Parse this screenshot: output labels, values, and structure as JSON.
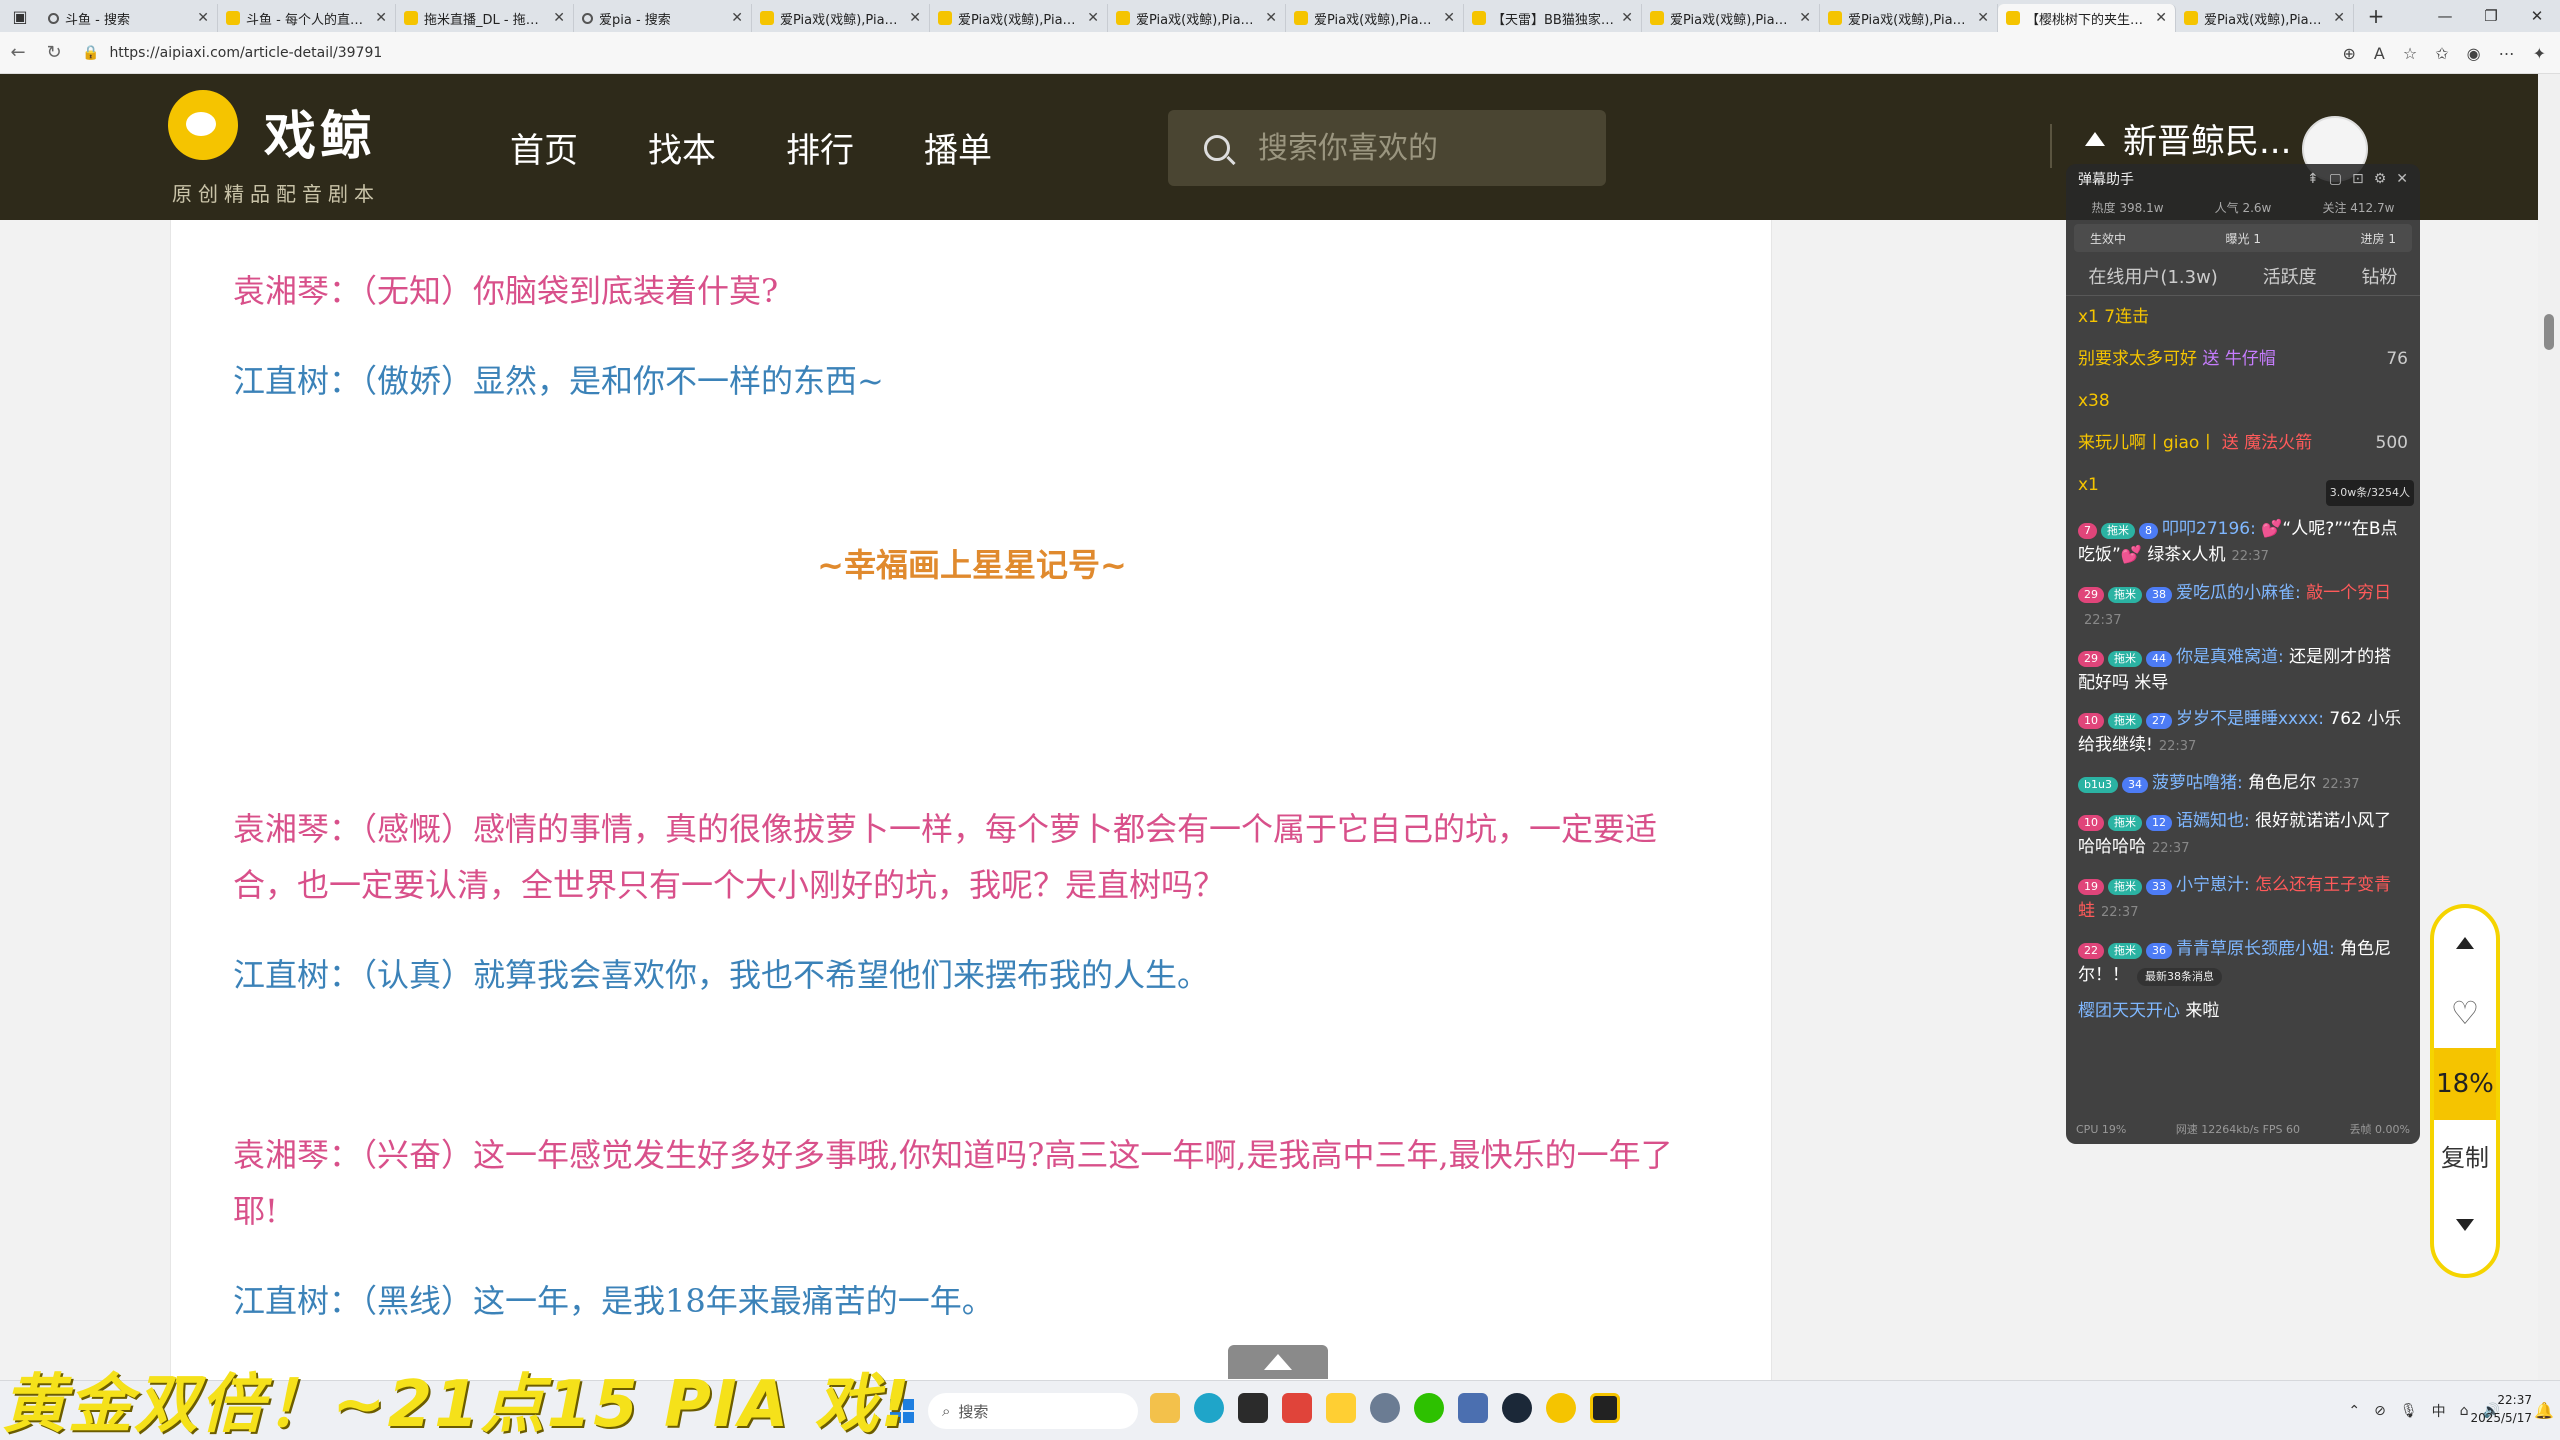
{
  "browser": {
    "tabs": [
      {
        "title": "斗鱼 - 搜索",
        "fav": "search"
      },
      {
        "title": "斗鱼 - 每个人的直播平台",
        "fav": "site"
      },
      {
        "title": "拖米直播_DL - 拖米直播",
        "fav": "site"
      },
      {
        "title": "爱pia - 搜索",
        "fav": "search"
      },
      {
        "title": "爱Pia戏(戏鲸),Pia戏剧本",
        "fav": "site"
      },
      {
        "title": "爱Pia戏(戏鲸),Pia戏剧本",
        "fav": "site"
      },
      {
        "title": "爱Pia戏(戏鲸),Pia戏剧本",
        "fav": "site"
      },
      {
        "title": "爱Pia戏(戏鲸),Pia戏剧本",
        "fav": "site"
      },
      {
        "title": "【天雷】BB猫独家剧本",
        "fav": "site"
      },
      {
        "title": "爱Pia戏(戏鲸),Pia戏剧本",
        "fav": "site"
      },
      {
        "title": "爱Pia戏(戏鲸),Pia戏剧本",
        "fav": "site"
      },
      {
        "title": "【樱桃树下的夹生本】",
        "fav": "site",
        "active": true
      },
      {
        "title": "爱Pia戏(戏鲸),Pia戏剧本",
        "fav": "site"
      }
    ],
    "url": "https://aipiaxi.com/article-detail/39791"
  },
  "site": {
    "logo_name": "戏鲸",
    "logo_slogan": "原创精品配音剧本",
    "nav": [
      "首页",
      "找本",
      "排行",
      "播单"
    ],
    "search_placeholder": "搜索你喜欢的",
    "username": "新晋鲸民..."
  },
  "article": {
    "lines": [
      {
        "text": "袁湘琴：（无知）你脑袋到底装着什莫?",
        "color": "pink"
      },
      {
        "text": "江直树：（傲娇）显然，是和你不一样的东西~",
        "color": "blue"
      },
      {
        "text": "~幸福画上星星记号~",
        "color": "title"
      },
      {
        "text": "袁湘琴：（感慨）感情的事情，真的很像拔萝卜一样，每个萝卜都会有一个属于它自己的坑，一定要适",
        "color": "pink"
      },
      {
        "text": "合，也一定要认清，全世界只有一个大小刚好的坑，我呢？是直树吗？",
        "color": "pink"
      },
      {
        "text": "江直树：（认真）就算我会喜欢你，我也不希望他们来摆布我的人生。",
        "color": "blue"
      },
      {
        "text": "袁湘琴：（兴奋）这一年感觉发生好多好多事哦,你知道吗?高三这一年啊,是我高中三年,最快乐的一年了",
        "color": "pink"
      },
      {
        "text": "耶!",
        "color": "pink"
      },
      {
        "text": "江直树：（黑线）这一年，是我18年来最痛苦的一年。",
        "color": "blue"
      }
    ]
  },
  "danmaku": {
    "title": "弹幕助手",
    "stats": [
      "热度 398.1w",
      "人气 2.6w",
      "关注 412.7w"
    ],
    "live_status": "生效中",
    "exposure": "曝光 1",
    "enter": "进房 1",
    "tabs": [
      "在线用户(1.3w)",
      "活跃度",
      "钻粉"
    ],
    "gifts": [
      {
        "pre": "x1 7连击",
        "name": "",
        "amt": ""
      },
      {
        "pre": "别要求太多可好 ",
        "name": "送 牛仔帽",
        "amt": "76"
      },
      {
        "pre": "x38",
        "name": "",
        "amt": ""
      },
      {
        "pre": "来玩儿啊丨giao丨 ",
        "name": "送 魔法火箭",
        "amt": "500"
      },
      {
        "pre": "x1",
        "name": "",
        "amt": ""
      }
    ],
    "messages": [
      {
        "lv": "7",
        "tag": "拖米",
        "fan": "8",
        "nick": "叩叩27196:",
        "text": "💕“人呢?”“在B点吃饭”💕 绿茶x人机",
        "time": "22:37"
      },
      {
        "lv": "29",
        "tag": "拖米",
        "fan": "38",
        "nick": "爱吃瓜的小麻雀:",
        "text": "",
        "red": "敲一个穷日",
        "time": "22:37"
      },
      {
        "lv": "29",
        "tag": "拖米",
        "fan": "44",
        "nick": "你是真难窝道:",
        "text": "还是刚才的搭配好吗 米导",
        "time": ""
      },
      {
        "lv": "10",
        "tag": "拖米",
        "fan": "27",
        "nick": "岁岁不是睡睡xxxx:",
        "text": "762 小乐 给我继续!",
        "time": "22:37"
      },
      {
        "lv": "",
        "tag": "b1u3",
        "fan": "34",
        "nick": "菠萝咕噜猪:",
        "text": "角色尼尔",
        "time": "22:37"
      },
      {
        "lv": "10",
        "tag": "拖米",
        "fan": "12",
        "nick": "语嫣知也:",
        "text": "很好就诺诺小风了哈哈哈哈",
        "time": "22:37"
      },
      {
        "lv": "19",
        "tag": "拖米",
        "fan": "33",
        "nick": "小宁崽汁:",
        "text": "",
        "red": "怎么还有王子变青蛙",
        "time": "22:37"
      },
      {
        "lv": "22",
        "tag": "拖米",
        "fan": "36",
        "nick": "青青草原长颈鹿小姐:",
        "text": "角色尼尔！！",
        "time": ""
      },
      {
        "lv": "",
        "tag": "",
        "fan": "",
        "nick": "樱团天天开心",
        "text": "来啦",
        "time": ""
      }
    ],
    "new_msgs": "最新38条消息",
    "online_tip": "3.0w条/3254人",
    "footer": [
      "CPU 19%",
      "网速 12264kb/s FPS 60",
      "丢帧 0.00%"
    ]
  },
  "sidetools": {
    "percent": "18%",
    "copy": "复制"
  },
  "overlay_text": "黄金双倍！~21点15 PIA 戏!",
  "taskbar": {
    "search": "搜索",
    "time": "22:37",
    "date": "2025/5/17",
    "ime": "中"
  },
  "colors": {
    "header_bg": "#2e2a1a",
    "accent": "#f5c400",
    "pink_text": "#d8508a",
    "blue_text": "#3b82b8",
    "title_orange": "#e08a2e"
  }
}
